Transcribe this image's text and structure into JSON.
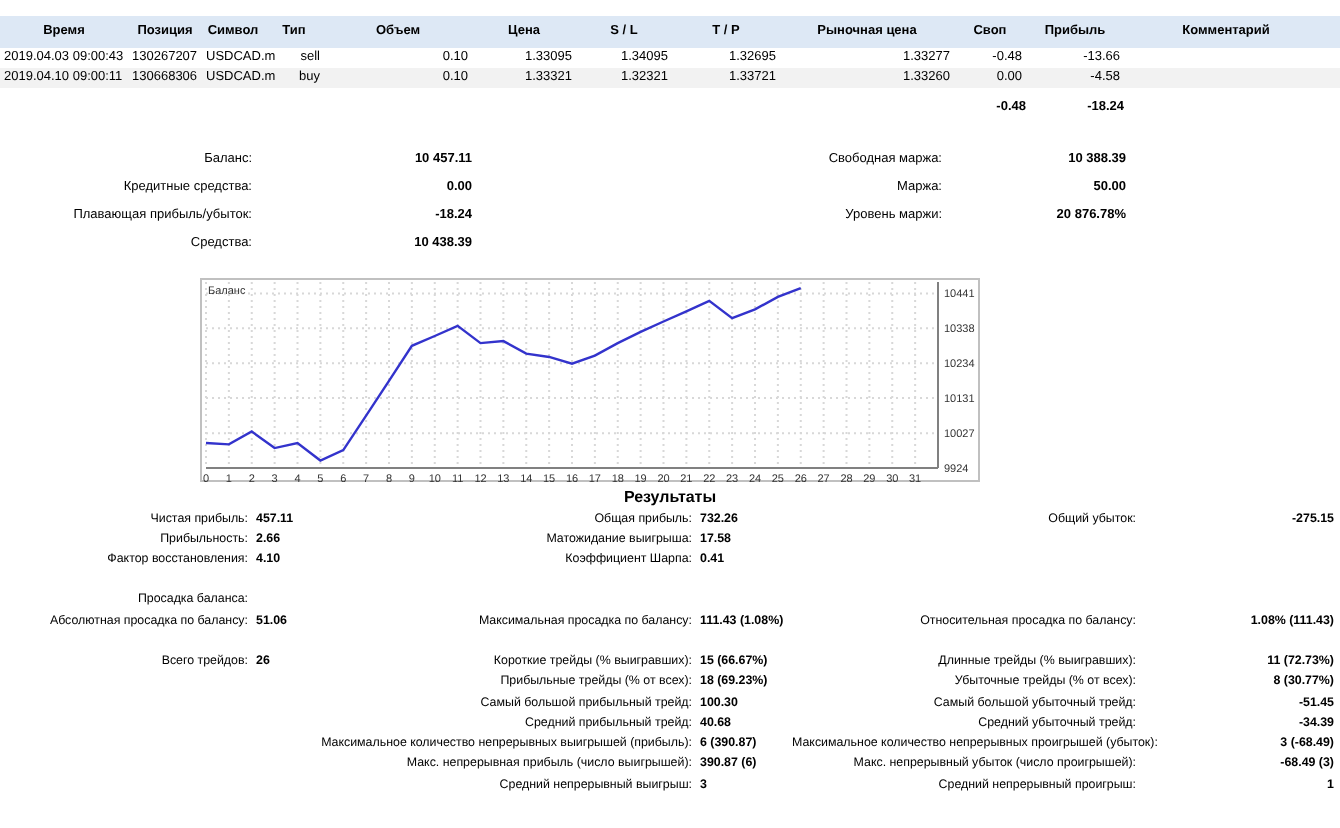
{
  "positions": {
    "columns": [
      "Время",
      "Позиция",
      "Символ",
      "Тип",
      "Объем",
      "Цена",
      "S / L",
      "T / P",
      "Рыночная цена",
      "Своп",
      "Прибыль",
      "Комментарий"
    ],
    "rows": [
      [
        "2019.04.03 09:00:43",
        "130267207",
        "USDCAD.m",
        "sell",
        "0.10",
        "1.33095",
        "1.34095",
        "1.32695",
        "1.33277",
        "-0.48",
        "-13.66"
      ],
      [
        "2019.04.10 09:00:11",
        "130668306",
        "USDCAD.m",
        "buy",
        "0.10",
        "1.33321",
        "1.32321",
        "1.33721",
        "1.33260",
        "0.00",
        "-4.58"
      ]
    ],
    "totals": {
      "swap": "-0.48",
      "profit": "-18.24"
    }
  },
  "account": [
    {
      "left": {
        "label": "Баланс:",
        "value": "10 457.11"
      },
      "right": {
        "label": "Свободная маржа:",
        "value": "10 388.39"
      }
    },
    {
      "left": {
        "label": "Кредитные средства:",
        "value": "0.00"
      },
      "right": {
        "label": "Маржа:",
        "value": "50.00"
      }
    },
    {
      "left": {
        "label": "Плавающая прибыль/убыток:",
        "value": "-18.24"
      },
      "right": {
        "label": "Уровень маржи:",
        "value": "20 876.78%"
      }
    },
    {
      "left": {
        "label": "Средства:",
        "value": "10 438.39"
      }
    }
  ],
  "chart": {
    "chart_data": {
      "type": "line",
      "grid": true,
      "x": [
        0,
        1,
        2,
        3,
        4,
        5,
        6,
        7,
        8,
        9,
        10,
        11,
        12,
        13,
        14,
        15,
        16,
        17,
        18,
        19,
        20,
        21,
        22,
        23,
        24,
        25,
        26
      ],
      "series": [
        {
          "name": "Баланс",
          "color": "#3333cc",
          "values": [
            9998,
            9994,
            10032,
            9983,
            9998,
            9946,
            9977,
            10079,
            10182,
            10286,
            10315,
            10345,
            10294,
            10300,
            10263,
            10253,
            10233,
            10257,
            10294,
            10327,
            10358,
            10388,
            10419,
            10368,
            10394,
            10431,
            10457
          ]
        }
      ],
      "xlim": [
        0,
        32
      ],
      "ylim": [
        9924,
        10475
      ],
      "xticks": [
        0,
        1,
        2,
        3,
        4,
        5,
        6,
        7,
        8,
        9,
        10,
        11,
        12,
        13,
        14,
        15,
        16,
        17,
        18,
        19,
        20,
        21,
        22,
        23,
        24,
        25,
        26,
        27,
        28,
        29,
        30,
        31
      ],
      "yticks": [
        9924,
        10027,
        10131,
        10234,
        10338,
        10441
      ]
    }
  },
  "results": {
    "title": "Результаты",
    "groups": [
      [
        {
          "left": {
            "label": "Чистая прибыль:",
            "value": "457.11"
          },
          "middle": {
            "label": "Общая прибыль:",
            "value": "732.26"
          },
          "right": {
            "label": "Общий убыток:",
            "value": "-275.15"
          }
        },
        {
          "left": {
            "label": "Прибыльность:",
            "value": "2.66"
          },
          "middle": {
            "label": "Матожидание выигрыша:",
            "value": "17.58"
          }
        },
        {
          "left": {
            "label": "Фактор восстановления:",
            "value": "4.10"
          },
          "middle": {
            "label": "Коэффициент Шарпа:",
            "value": "0.41"
          }
        }
      ],
      [
        {
          "left": {
            "label": "Просадка баланса:"
          }
        },
        {
          "left": {
            "label": "Абсолютная просадка по балансу:",
            "value": "51.06"
          },
          "middle": {
            "label": "Максимальная просадка по балансу:",
            "value": "111.43 (1.08%)"
          },
          "right": {
            "label": "Относительная просадка по балансу:",
            "value": "1.08% (111.43)"
          }
        }
      ],
      [
        {
          "left": {
            "label": "Всего трейдов:",
            "value": "26"
          },
          "middle": {
            "label": "Короткие трейды (% выигравших):",
            "value": "15 (66.67%)"
          },
          "right": {
            "label": "Длинные трейды (% выигравших):",
            "value": "11 (72.73%)"
          }
        },
        {
          "middle": {
            "label": "Прибыльные трейды (% от всех):",
            "value": "18 (69.23%)"
          },
          "right": {
            "label": "Убыточные трейды (% от всех):",
            "value": "8 (30.77%)"
          }
        },
        {
          "middle": {
            "label": "Самый большой прибыльный трейд:",
            "value": "100.30"
          },
          "right": {
            "label": "Самый большой убыточный трейд:",
            "value": "-51.45"
          }
        },
        {
          "middle": {
            "label": "Средний прибыльный трейд:",
            "value": "40.68"
          },
          "right": {
            "label": "Средний убыточный трейд:",
            "value": "-34.39"
          }
        },
        {
          "middle": {
            "label": "Максимальное количество непрерывных выигрышей (прибыль):",
            "value": "6 (390.87)"
          },
          "right": {
            "label": "Максимальное количество непрерывных проигрышей (убыток):",
            "value": "3 (-68.49)"
          }
        },
        {
          "middle": {
            "label": "Макс. непрерывная прибыль (число выигрышей):",
            "value": "390.87 (6)"
          },
          "right": {
            "label": "Макс. непрерывный убыток (число проигрышей):",
            "value": "-68.49 (3)"
          }
        },
        {
          "middle": {
            "label": "Средний непрерывный выигрыш:",
            "value": "3"
          },
          "right": {
            "label": "Средний непрерывный проигрыш:",
            "value": "1"
          }
        }
      ]
    ]
  }
}
